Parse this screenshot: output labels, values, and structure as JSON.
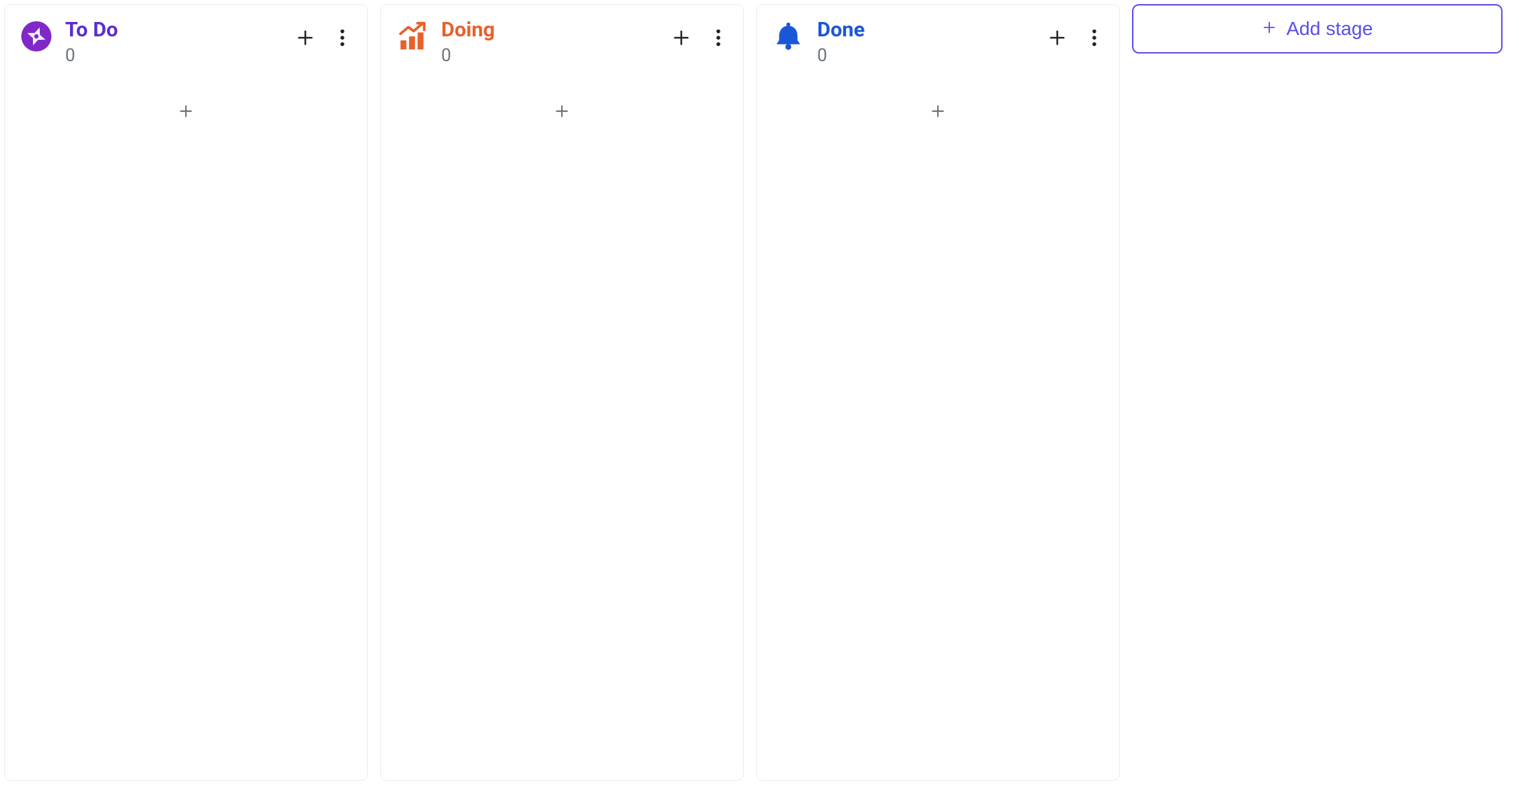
{
  "columns": [
    {
      "title": "To Do",
      "count": "0",
      "titleColor": "#5b2ed0",
      "icon": "compass-icon",
      "iconColor": "#8128c9"
    },
    {
      "title": "Doing",
      "count": "0",
      "titleColor": "#e8602c",
      "icon": "chart-up-icon",
      "iconColor": "#e8602c"
    },
    {
      "title": "Done",
      "count": "0",
      "titleColor": "#1957d6",
      "icon": "bell-icon",
      "iconColor": "#1957d6"
    }
  ],
  "addStage": {
    "label": "Add stage"
  }
}
